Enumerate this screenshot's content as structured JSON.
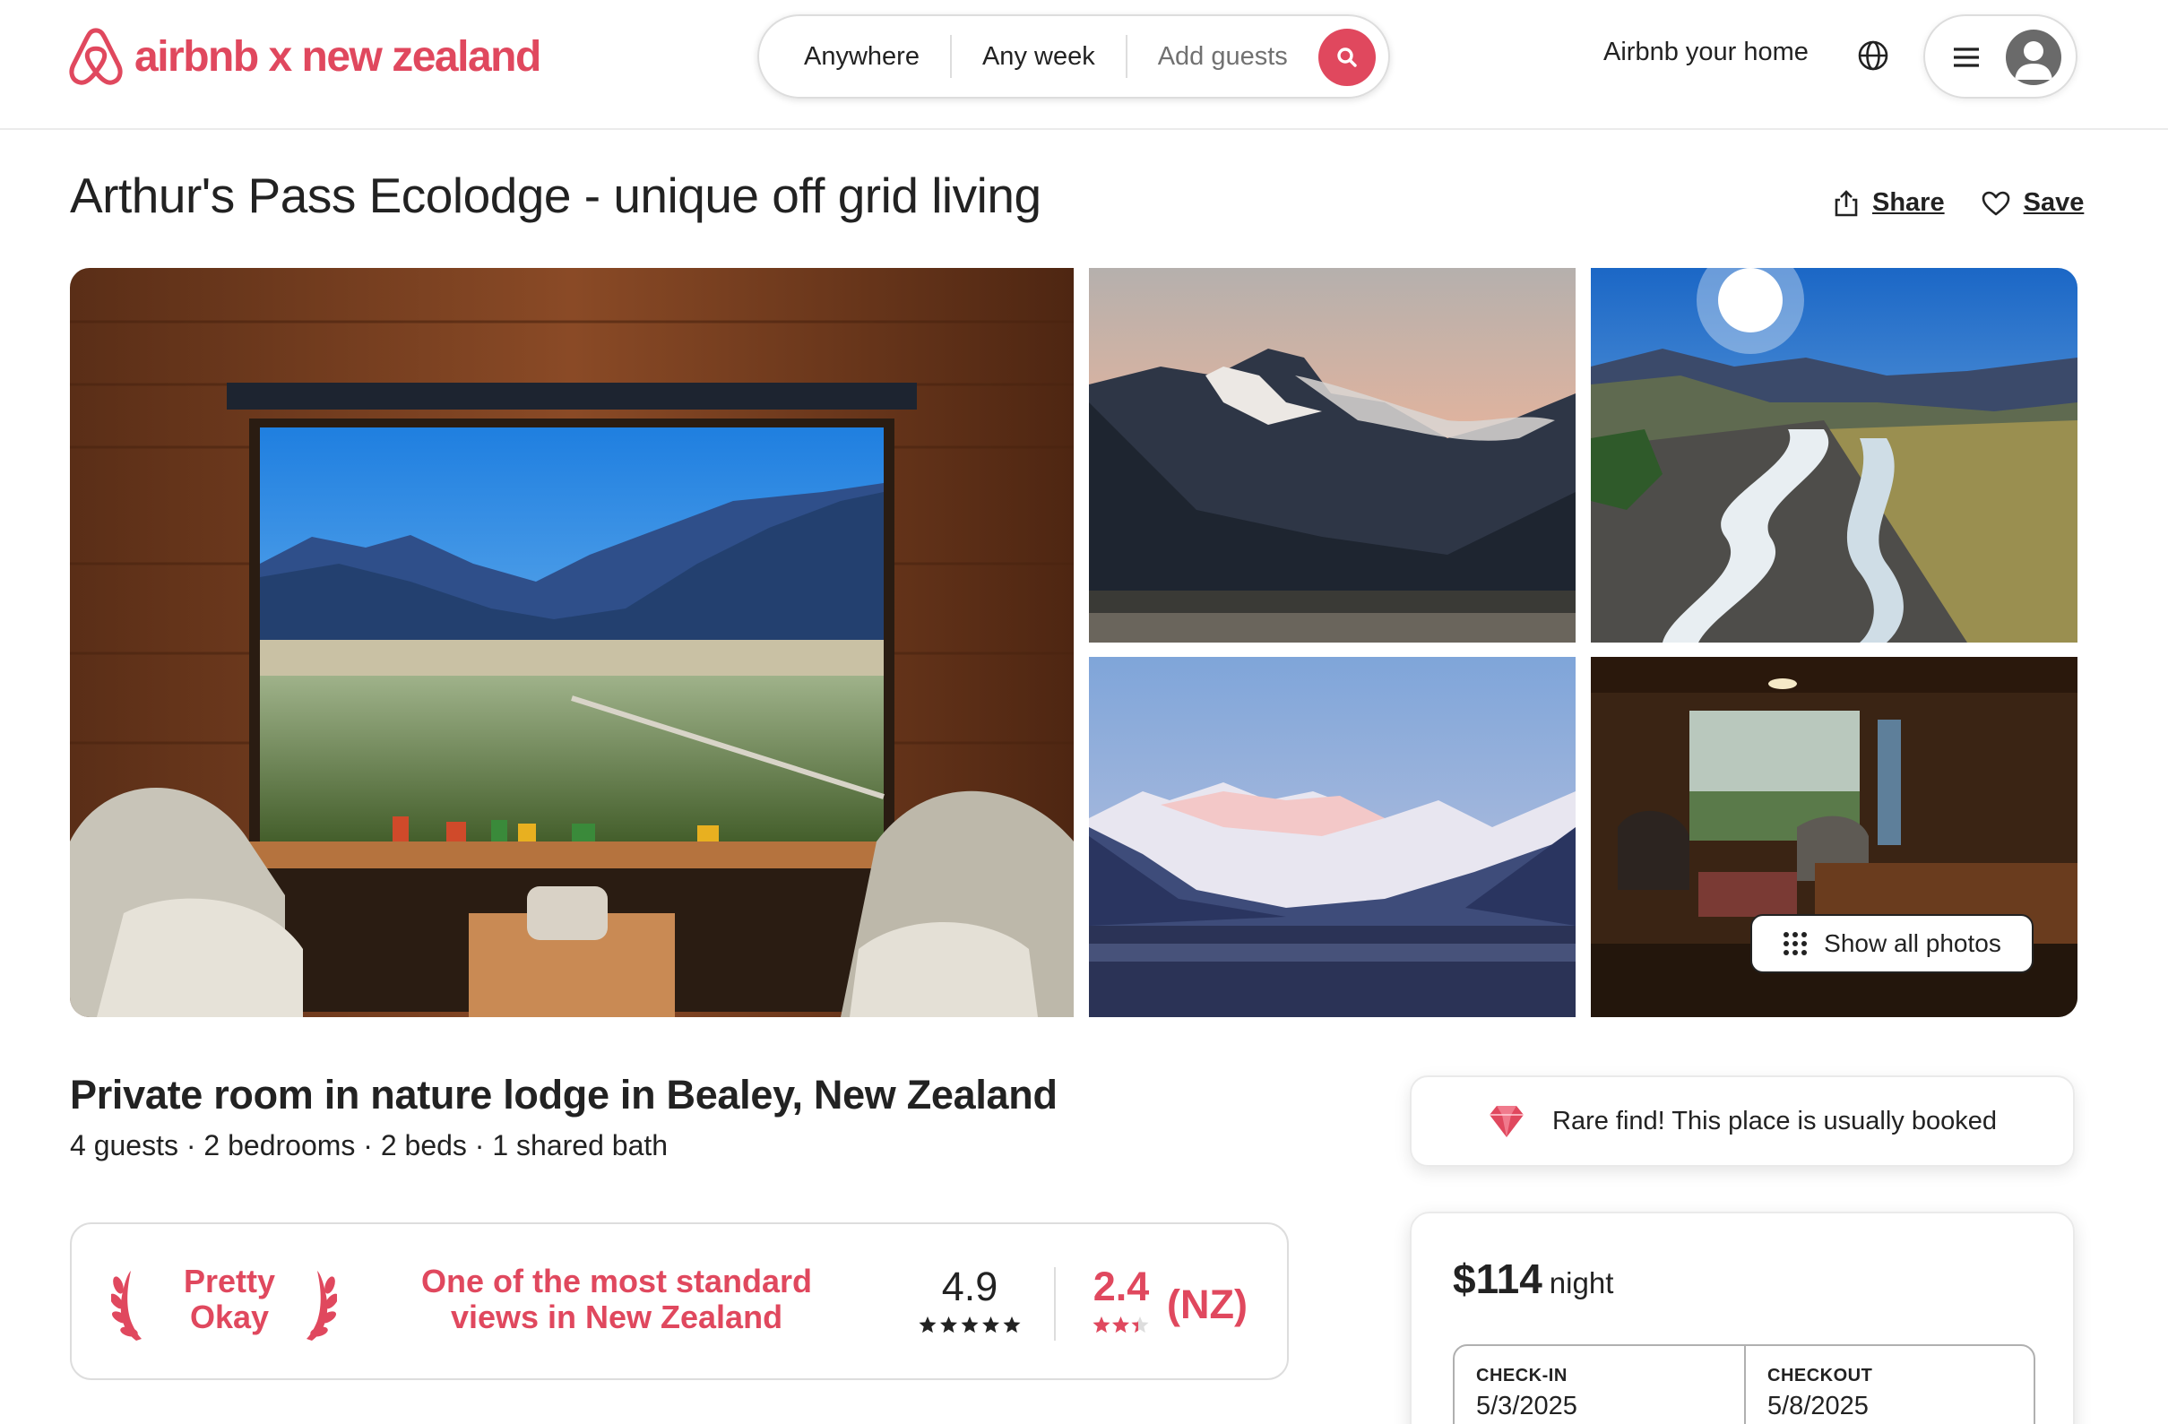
{
  "brand": {
    "name": "airbnb x new zealand",
    "color": "#e0485e"
  },
  "search": {
    "where": "Anywhere",
    "when": "Any week",
    "who": "Add guests"
  },
  "header": {
    "host_link": "Airbnb your home"
  },
  "listing": {
    "title": "Arthur's Pass Ecolodge - unique off grid living",
    "share_label": "Share",
    "save_label": "Save",
    "show_photos_label": "Show all photos",
    "subtitle": "Private room in nature lodge in Bealey, New Zealand",
    "specs": "4 guests · 2 bedrooms · 2 beds · 1 shared bath"
  },
  "badge": {
    "pretty": "Pretty Okay",
    "views": "One of the most standard views in New Zealand",
    "rating": "4.9",
    "stars": 5,
    "nz_rating": "2.4",
    "nz_stars": 2.4,
    "nz_label": "(NZ)"
  },
  "rare": {
    "text": "Rare find! This place is usually booked"
  },
  "booking": {
    "price": "$114",
    "per": "night",
    "checkin_label": "CHECK-IN",
    "checkin_value": "5/3/2025",
    "checkout_label": "CHECKOUT",
    "checkout_value": "5/8/2025"
  }
}
